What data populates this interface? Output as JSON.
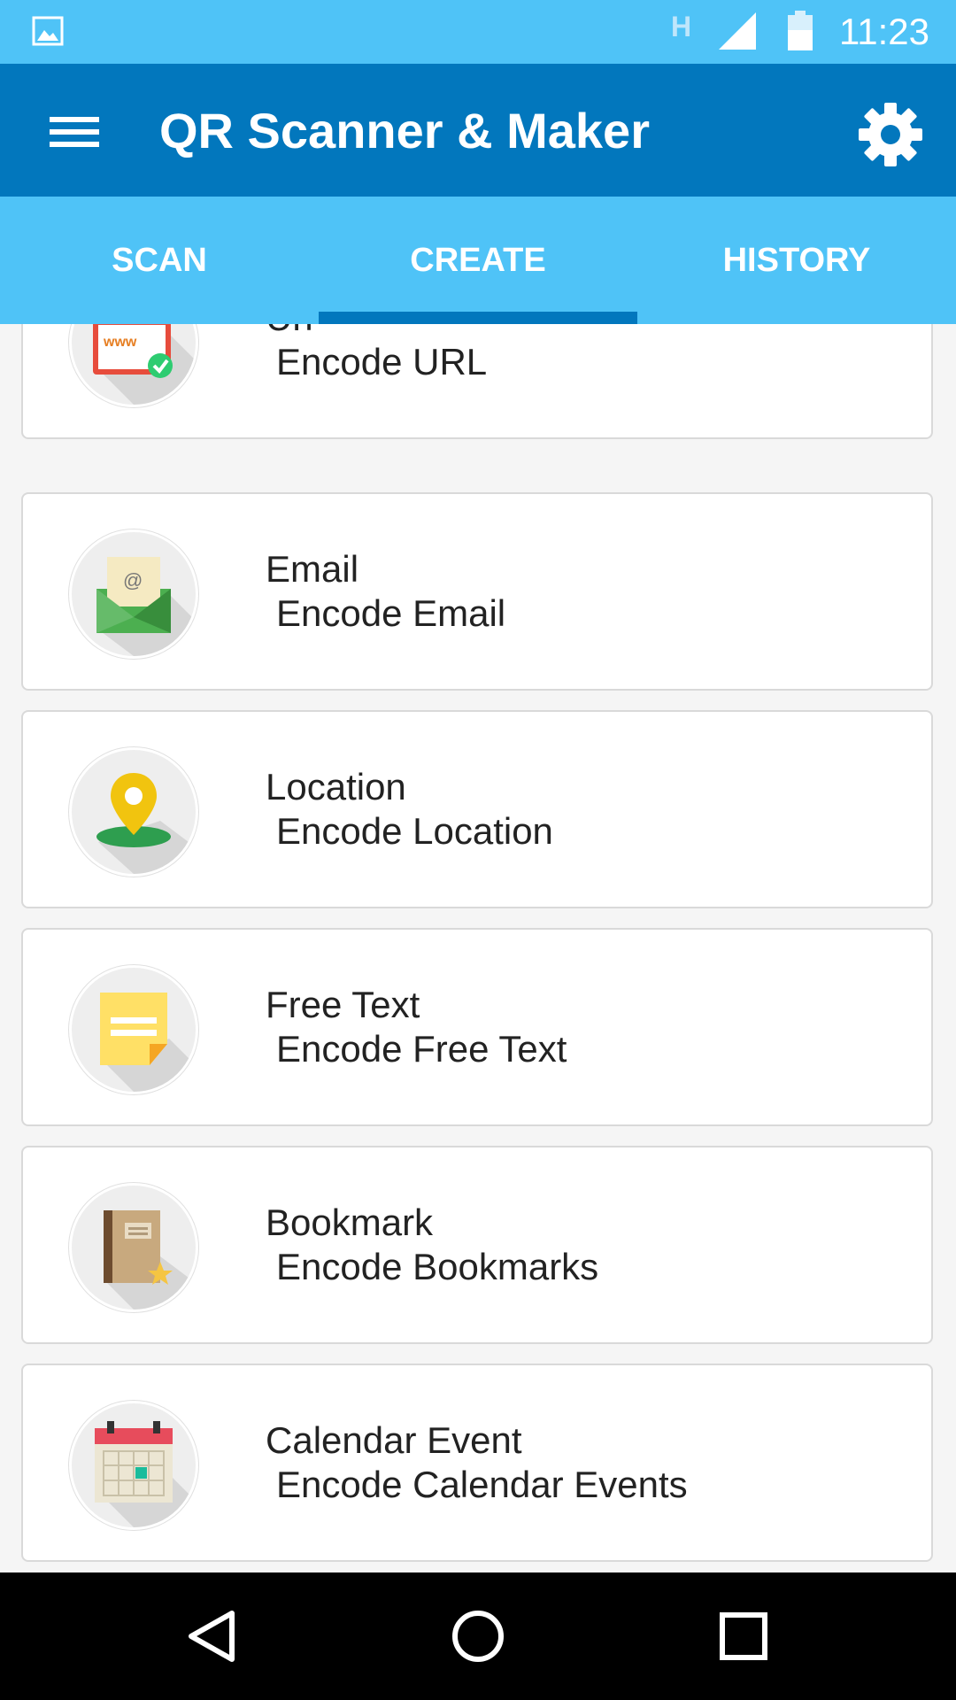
{
  "status_bar": {
    "time": "11:23",
    "network_type": "H",
    "icons": [
      "gallery-icon",
      "signal-icon",
      "battery-icon"
    ]
  },
  "app_bar": {
    "title": "QR Scanner & Maker",
    "menu_icon": "hamburger-menu-icon",
    "settings_icon": "gear-icon"
  },
  "tabs": [
    {
      "label": "SCAN",
      "selected": false
    },
    {
      "label": "CREATE",
      "selected": true
    },
    {
      "label": "HISTORY",
      "selected": false
    }
  ],
  "create_items": [
    {
      "title": "Url",
      "subtitle": " Encode URL",
      "icon": "www-browser-icon"
    },
    {
      "title": "Email",
      "subtitle": " Encode Email",
      "icon": "email-envelope-icon"
    },
    {
      "title": "Location",
      "subtitle": " Encode Location",
      "icon": "location-pin-icon"
    },
    {
      "title": "Free Text",
      "subtitle": " Encode Free Text",
      "icon": "sticky-note-icon"
    },
    {
      "title": "Bookmark",
      "subtitle": " Encode Bookmarks",
      "icon": "bookmark-book-icon"
    },
    {
      "title": "Calendar Event",
      "subtitle": " Encode Calendar Events",
      "icon": "calendar-icon"
    }
  ],
  "nav_bar": {
    "icons": [
      "back-icon",
      "home-icon",
      "recents-icon"
    ]
  },
  "colors": {
    "status_bar": "#4fc3f7",
    "app_bar": "#0277bd",
    "tab_bar": "#4fc3f7",
    "tab_indicator": "#0277bd"
  }
}
